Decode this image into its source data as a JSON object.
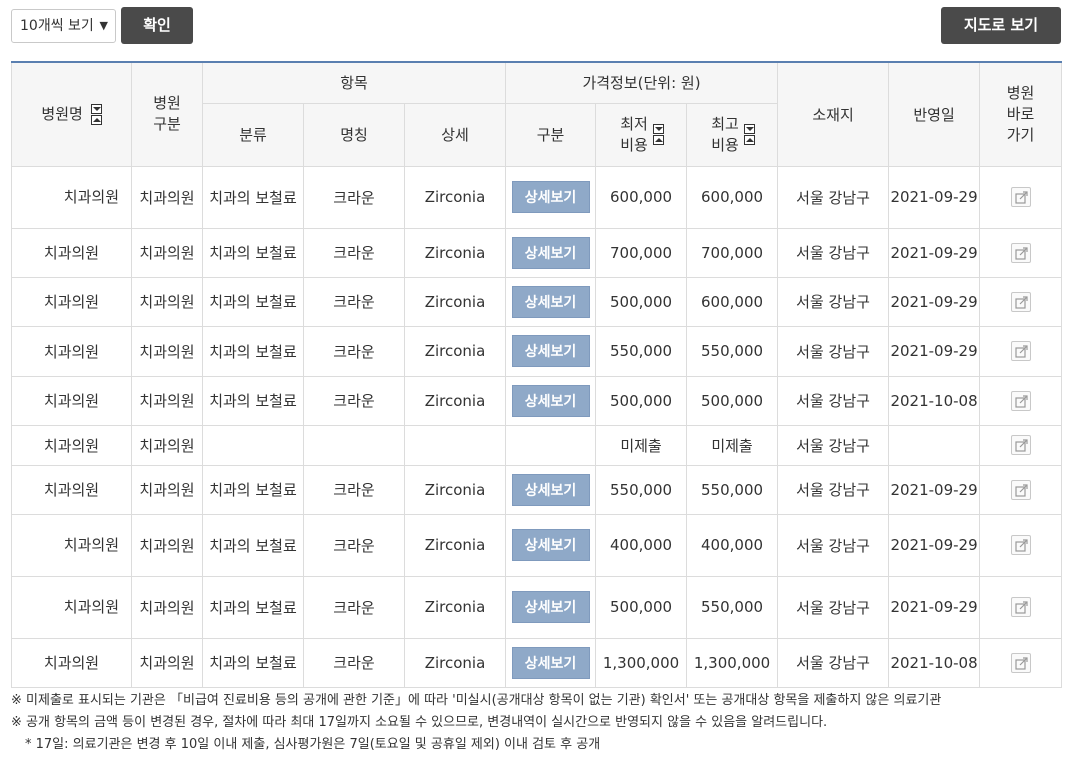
{
  "toolbar": {
    "page_size_selected": "10개씩 보기",
    "confirm_label": "확인",
    "map_label": "지도로 보기"
  },
  "table": {
    "headers": {
      "hospital_name": "병원명",
      "hospital_type": "병원 구분",
      "item_group": "항목",
      "price_group": "가격정보(단위: 원)",
      "location": "소재지",
      "reflected_date": "반영일",
      "go_hospital": "병원 바로 가기",
      "category": "분류",
      "name": "명칭",
      "detail": "상세",
      "division": "구분",
      "min_cost": "최저 비용",
      "max_cost": "최고 비용"
    },
    "detail_button_label": "상세보기",
    "rows": [
      {
        "name": "치과의원",
        "type": "치과의원",
        "category": "치과의 보철료",
        "item": "크라운",
        "detail": "Zirconia",
        "has_detail": true,
        "min": "600,000",
        "max": "600,000",
        "location": "서울 강남구",
        "date": "2021-09-29"
      },
      {
        "name": "치과의원",
        "type": "치과의원",
        "category": "치과의 보철료",
        "item": "크라운",
        "detail": "Zirconia",
        "has_detail": true,
        "min": "700,000",
        "max": "700,000",
        "location": "서울 강남구",
        "date": "2021-09-29"
      },
      {
        "name": "치과의원",
        "type": "치과의원",
        "category": "치과의 보철료",
        "item": "크라운",
        "detail": "Zirconia",
        "has_detail": true,
        "min": "500,000",
        "max": "600,000",
        "location": "서울 강남구",
        "date": "2021-09-29"
      },
      {
        "name": "치과의원",
        "type": "치과의원",
        "category": "치과의 보철료",
        "item": "크라운",
        "detail": "Zirconia",
        "has_detail": true,
        "min": "550,000",
        "max": "550,000",
        "location": "서울 강남구",
        "date": "2021-09-29"
      },
      {
        "name": "치과의원",
        "type": "치과의원",
        "category": "치과의 보철료",
        "item": "크라운",
        "detail": "Zirconia",
        "has_detail": true,
        "min": "500,000",
        "max": "500,000",
        "location": "서울 강남구",
        "date": "2021-10-08"
      },
      {
        "name": "치과의원",
        "type": "치과의원",
        "category": "",
        "item": "",
        "detail": "",
        "has_detail": false,
        "min": "미제출",
        "max": "미제출",
        "location": "서울 강남구",
        "date": ""
      },
      {
        "name": "치과의원",
        "type": "치과의원",
        "category": "치과의 보철료",
        "item": "크라운",
        "detail": "Zirconia",
        "has_detail": true,
        "min": "550,000",
        "max": "550,000",
        "location": "서울 강남구",
        "date": "2021-09-29"
      },
      {
        "name": "치과의원",
        "type": "치과의원",
        "category": "치과의 보철료",
        "item": "크라운",
        "detail": "Zirconia",
        "has_detail": true,
        "min": "400,000",
        "max": "400,000",
        "location": "서울 강남구",
        "date": "2021-09-29"
      },
      {
        "name": "치과의원",
        "type": "치과의원",
        "category": "치과의 보철료",
        "item": "크라운",
        "detail": "Zirconia",
        "has_detail": true,
        "min": "500,000",
        "max": "550,000",
        "location": "서울 강남구",
        "date": "2021-09-29"
      },
      {
        "name": "치과의원",
        "type": "치과의원",
        "category": "치과의 보철료",
        "item": "크라운",
        "detail": "Zirconia",
        "has_detail": true,
        "min": "1,300,000",
        "max": "1,300,000",
        "location": "서울 강남구",
        "date": "2021-10-08"
      }
    ]
  },
  "notes": [
    "※ 미제출로 표시되는 기관은 「비급여 진료비용 등의 공개에 관한 기준」에 따라 '미실시(공개대상 항목이 없는 기관) 확인서' 또는 공개대상 항목을 제출하지 않은 의료기관",
    "※ 공개 항목의 금액 등이 변경된 경우, 절차에 따라 최대 17일까지 소요될 수 있으므로, 변경내역이 실시간으로 반영되지 않을 수 있음을 알려드립니다.",
    "* 17일: 의료기관은 변경 후 10일 이내 제출, 심사평가원은 7일(토요일 및 공휴일 제외) 이내 검토 후 공개"
  ]
}
